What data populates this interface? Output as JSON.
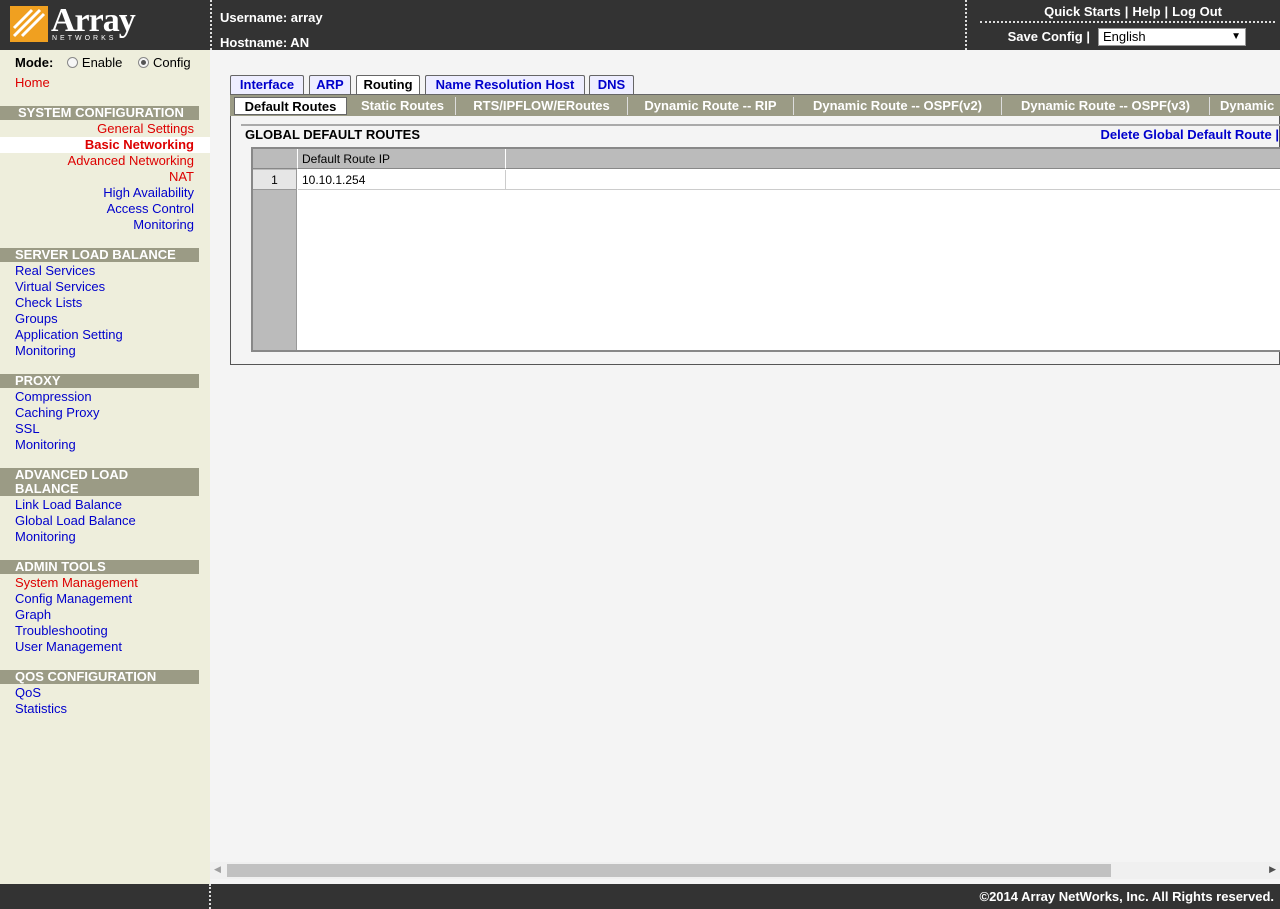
{
  "header": {
    "logo_text": "Array",
    "logo_sub": "NETWORKS",
    "username_label": "Username: array",
    "hostname_label": "Hostname: AN",
    "quick_starts": "Quick Starts",
    "help": "Help",
    "logout": "Log Out",
    "save_config": "Save Config",
    "separator": "|",
    "language_value": "English"
  },
  "sidebar": {
    "mode_label": "Mode:",
    "mode_enable": "Enable",
    "mode_config": "Config",
    "mode_selected": "Config",
    "home": "Home",
    "sections": [
      {
        "title": "SYSTEM CONFIGURATION",
        "items": [
          "General Settings",
          "Basic Networking",
          "Advanced Networking",
          "NAT",
          "High Availability",
          "Access Control",
          "Monitoring"
        ]
      },
      {
        "title": "SERVER LOAD BALANCE",
        "items": [
          "Real Services",
          "Virtual Services",
          "Check Lists",
          "Groups",
          "Application Setting",
          "Monitoring"
        ]
      },
      {
        "title": "PROXY",
        "items": [
          "Compression",
          "Caching Proxy",
          "SSL",
          "Monitoring"
        ]
      },
      {
        "title_line1": "ADVANCED LOAD",
        "title_line2": "BALANCE",
        "items": [
          "Link Load Balance",
          "Global Load Balance",
          "Monitoring"
        ]
      },
      {
        "title": "ADMIN TOOLS",
        "items": [
          "System Management",
          "Config Management",
          "Graph",
          "Troubleshooting",
          "User Management"
        ]
      },
      {
        "title": "QOS CONFIGURATION",
        "items": [
          "QoS",
          "Statistics"
        ]
      }
    ]
  },
  "tabs": {
    "primary": [
      "Interface",
      "ARP",
      "Routing",
      "Name Resolution Host",
      "DNS"
    ],
    "primary_active": "Routing",
    "secondary": [
      "Default Routes",
      "Static Routes",
      "RTS/IPFLOW/ERoutes",
      "Dynamic Route -- RIP",
      "Dynamic Route -- OSPF(v2)",
      "Dynamic Route -- OSPF(v3)",
      "Dynamic"
    ],
    "secondary_active": "Default Routes"
  },
  "content": {
    "section_title": "GLOBAL DEFAULT ROUTES",
    "delete_link": "Delete Global Default Route |",
    "table": {
      "columns": [
        "Default Route IP",
        ""
      ],
      "rows": [
        {
          "num": "1",
          "ip": "10.10.1.254"
        }
      ]
    }
  },
  "footer": {
    "copyright": "©2014 Array NetWorks, Inc. All Rights reserved."
  },
  "colors": {
    "header_bg": "#333333",
    "sidebar_bg": "#eeeedc",
    "section_bg": "#9b9b85",
    "link_blue": "#0000cc",
    "link_red": "#dd0000",
    "logo_orange": "#f0a020"
  }
}
